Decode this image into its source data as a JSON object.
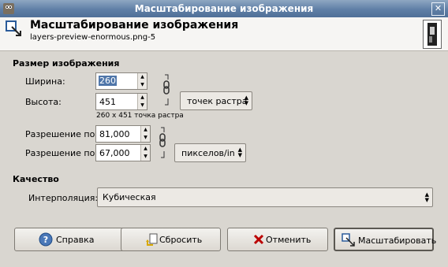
{
  "window": {
    "title": "Масштабирование изображения"
  },
  "header": {
    "title": "Масштабирование изображения",
    "subtitle": "layers-preview-enormous.png-5"
  },
  "image_size": {
    "section_title": "Размер изображения",
    "width_label": "Ширина:",
    "width_value": "260",
    "height_label": "Высота:",
    "height_value": "451",
    "size_info": "260 x 451 точка растра",
    "unit": "точек растра",
    "res_x_label": "Разрешение по X:",
    "res_x_value": "81,000",
    "res_y_label": "Разрешение по Y:",
    "res_y_value": "67,000",
    "res_unit": "пикселов/in"
  },
  "quality": {
    "section_title": "Качество",
    "interpolation_label": "Интерполяция:",
    "interpolation_value": "Кубическая"
  },
  "buttons": {
    "help": "Справка",
    "reset": "Сбросить",
    "cancel": "Отменить",
    "scale": "Масштабировать"
  },
  "icons": {
    "app": "gimp-app-icon",
    "close": "close-icon",
    "header": "scale-image-icon",
    "chain": "chain-link-icon",
    "help": "help-icon",
    "reset": "reset-icon",
    "cancel": "cancel-icon",
    "scale": "scale-icon"
  }
}
